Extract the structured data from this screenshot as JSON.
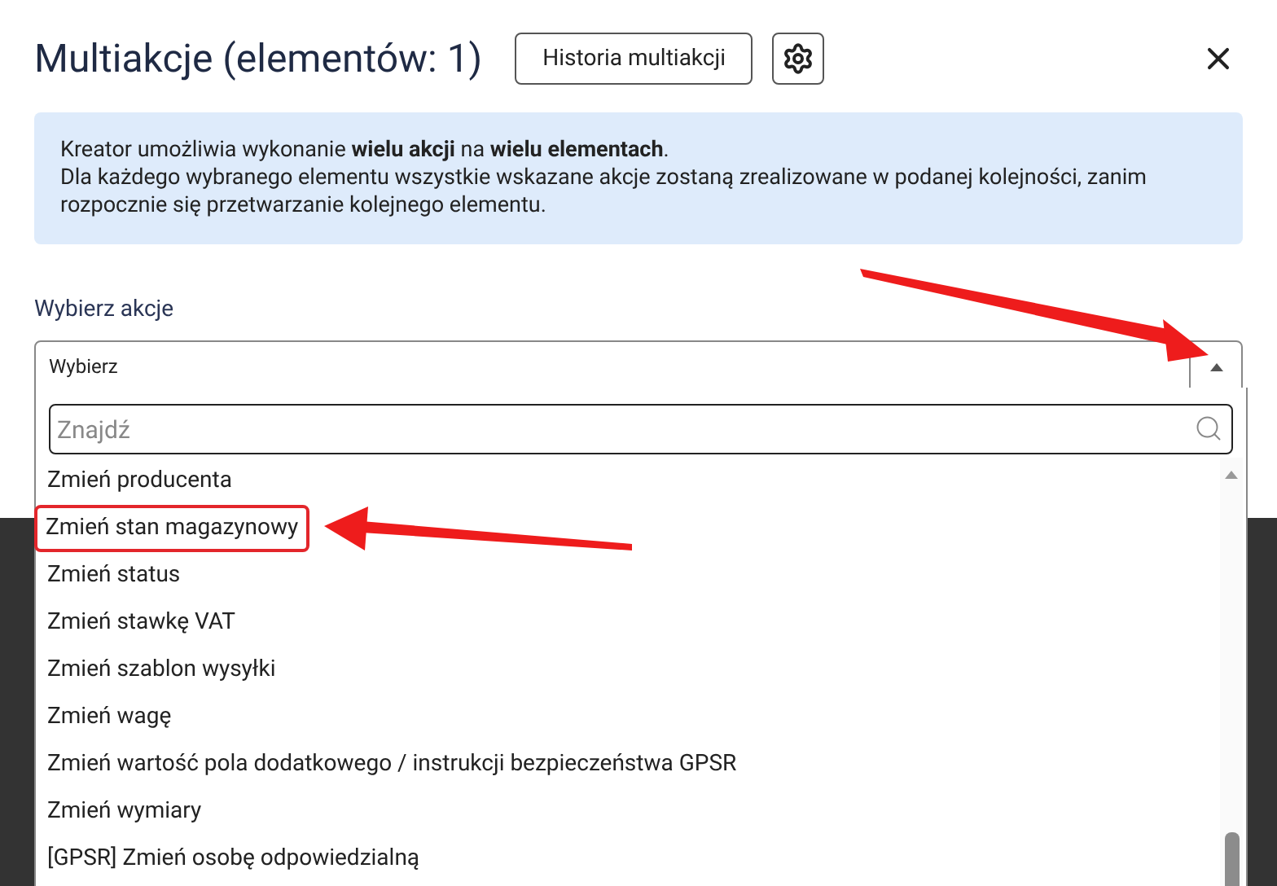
{
  "dialog": {
    "title": "Multiakcje (elementów: 1)",
    "history_button": "Historia multiakcji"
  },
  "info": {
    "line_1": "Kreator umożliwia wykonanie **wielu akcji** na **wielu elementach**.",
    "line_2": "Dla każdego wybranego elementu wszystkie wskazane akcje zostaną zrealizowane w podanej kolejności, zanim rozpocznie się przetwarzanie kolejnego elementu."
  },
  "action_select": {
    "label": "Wybierz akcje",
    "value": "Wybierz",
    "expanded": true,
    "search": {
      "placeholder": "Znajdź"
    },
    "options": [
      {
        "label": "Zmień producenta",
        "annotated": false
      },
      {
        "label": "Zmień stan magazynowy",
        "annotated": true
      },
      {
        "label": "Zmień status",
        "annotated": false
      },
      {
        "label": "Zmień stawkę VAT",
        "annotated": false
      },
      {
        "label": "Zmień szablon wysyłki",
        "annotated": false
      },
      {
        "label": "Zmień wagę",
        "annotated": false
      },
      {
        "label": "Zmień wartość pola dodatkowego / instrukcji bezpieczeństwa GPSR",
        "annotated": false
      },
      {
        "label": "Zmień wymiary",
        "annotated": false
      },
      {
        "label": "[GPSR] Zmień osobę odpowiedzialną",
        "annotated": false
      }
    ]
  }
}
